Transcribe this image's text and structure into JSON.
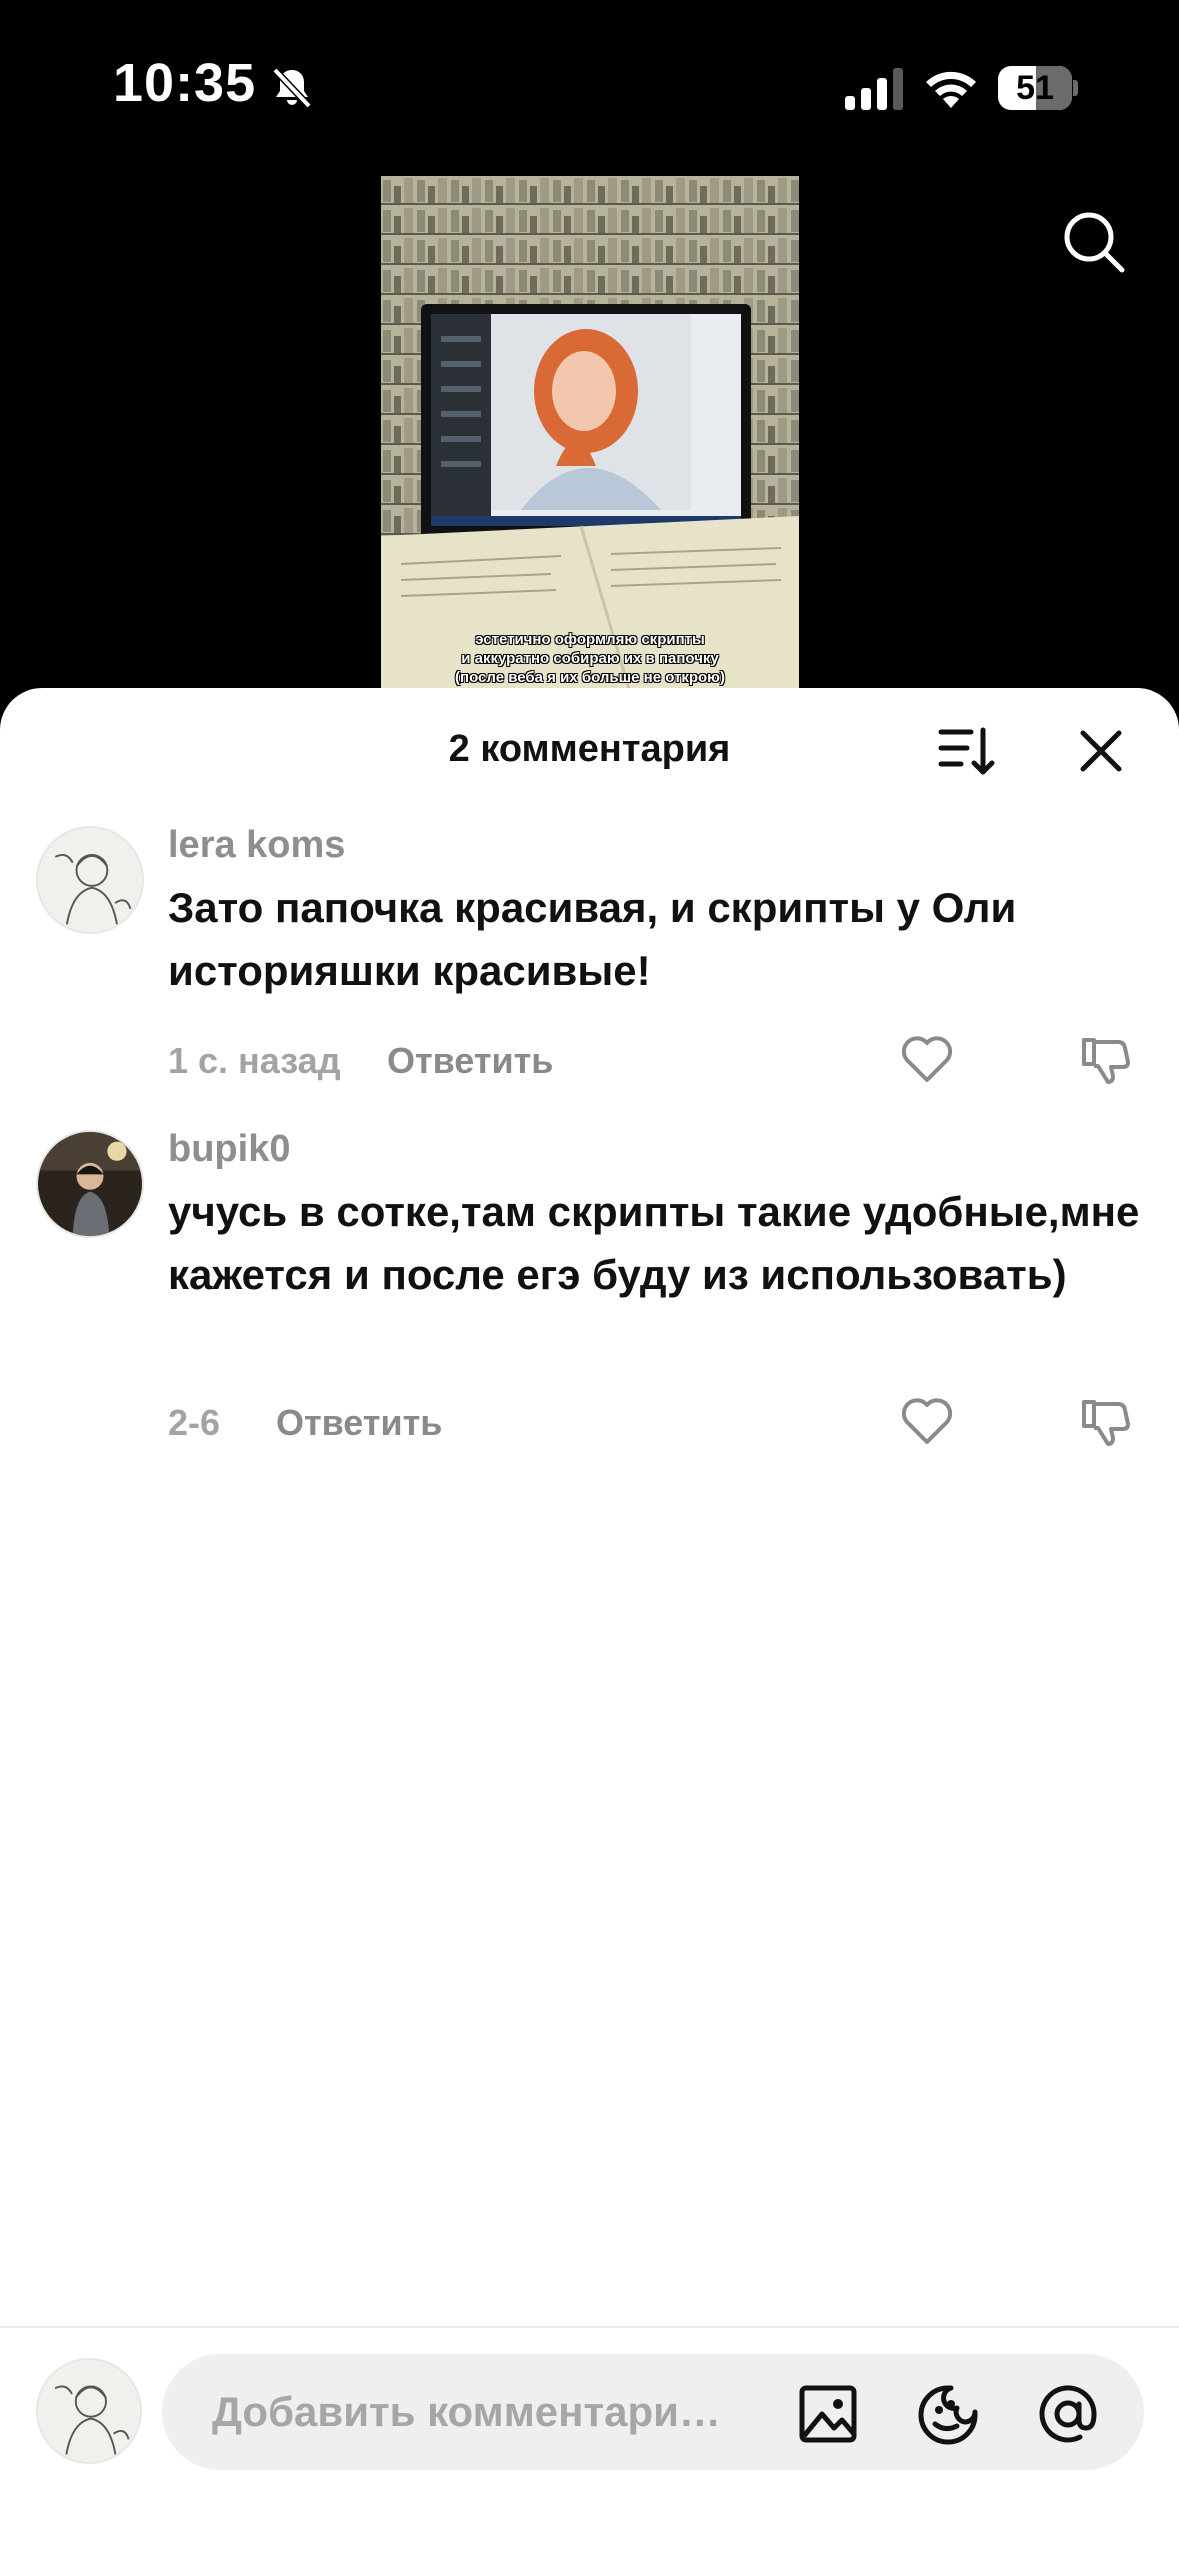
{
  "status_bar": {
    "time": "10:35",
    "battery_level": "51",
    "battery_fraction": 0.51,
    "icons": [
      "bell-off-icon",
      "cellular-signal-icon",
      "wifi-icon",
      "battery-icon"
    ]
  },
  "video": {
    "caption_lines": [
      "эстетично оформляю скрипты",
      "и аккуратно собираю их в папочку",
      "(после веба я их больше не открою)"
    ],
    "search_icon": "search-icon"
  },
  "comments_sheet": {
    "title": "2 комментария",
    "sort_icon": "sort-icon",
    "close_icon": "close-icon",
    "comments": [
      {
        "username": "lera koms",
        "text": "Зато папочка красивая, и скрипты у Оли историяшки красивые!",
        "time": "1 с. назад",
        "reply_label": "Ответить"
      },
      {
        "username": "bupik0",
        "text": "учусь в сотке,там скрипты такие удобные,мне кажется и после егэ буду из использовать)",
        "time": "2-6",
        "reply_label": "Ответить"
      }
    ]
  },
  "composer": {
    "placeholder": "Добавить комментари…",
    "icons": [
      "image-icon",
      "sticker-icon",
      "mention-icon"
    ]
  },
  "colors": {
    "background": "#000000",
    "sheet": "#ffffff",
    "muted_text": "#8e8e8e",
    "input_bg": "#efefef"
  }
}
